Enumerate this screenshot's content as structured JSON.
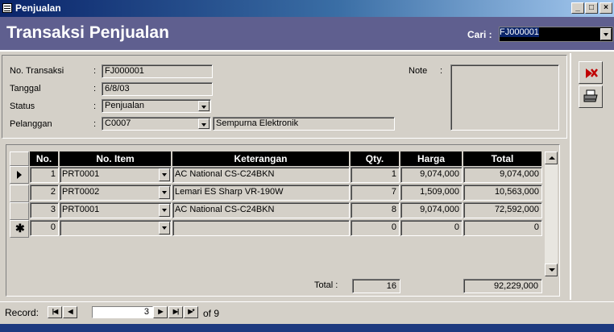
{
  "window": {
    "title": "Penjualan",
    "minimize": "_",
    "maximize": "□",
    "close": "×"
  },
  "header": {
    "heading": "Transaksi Penjualan",
    "cari_label": "Cari :",
    "cari_value": "FJ000001"
  },
  "form": {
    "no_transaksi_label": "No. Transaksi",
    "no_transaksi": "FJ000001",
    "tanggal_label": "Tanggal",
    "tanggal": "6/8/03",
    "status_label": "Status",
    "status": "Penjualan",
    "pelanggan_label": "Pelanggan",
    "pelanggan": "C0007",
    "pelanggan_nama": "Sempurna Elektronik",
    "colon": ":",
    "note_label": "Note",
    "note_colon": ":"
  },
  "grid": {
    "headers": {
      "no": "No.",
      "item": "No. Item",
      "ket": "Keterangan",
      "qty": "Qty.",
      "harga": "Harga",
      "total": "Total"
    },
    "rows": [
      {
        "no": "1",
        "item": "PRT0001",
        "ket": "AC National CS-C24BKN",
        "qty": "1",
        "harga": "9,074,000",
        "total": "9,074,000"
      },
      {
        "no": "2",
        "item": "PRT0002",
        "ket": "Lemari ES Sharp VR-190W",
        "qty": "7",
        "harga": "1,509,000",
        "total": "10,563,000"
      },
      {
        "no": "3",
        "item": "PRT0001",
        "ket": "AC National CS-C24BKN",
        "qty": "8",
        "harga": "9,074,000",
        "total": "72,592,000"
      }
    ],
    "new_row": {
      "no": "0",
      "item": "",
      "ket": "",
      "qty": "0",
      "harga": "0",
      "total": "0"
    }
  },
  "totals": {
    "label": "Total :",
    "qty": "16",
    "amount": "92,229,000"
  },
  "record_nav": {
    "label": "Record:",
    "current": "3",
    "of_text": "of 9",
    "first": "|◀",
    "prev": "◀",
    "next": "▶",
    "last": "▶|",
    "new": "▶*"
  },
  "icons": {
    "delete": "delete-icon",
    "print": "print-icon"
  },
  "colors": {
    "header_bg": "#5f5f8f",
    "delete_icon": "#c00000"
  }
}
